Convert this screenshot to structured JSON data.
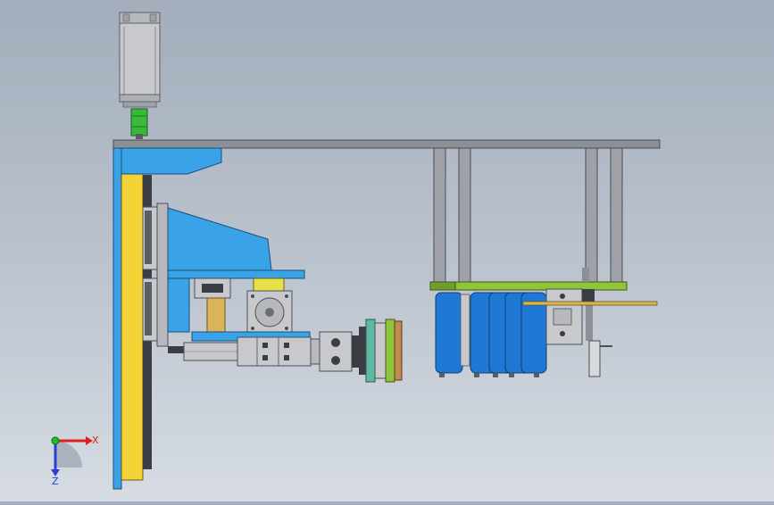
{
  "view": {
    "background_top": "#a3adbb",
    "background_bottom": "#d7dce3"
  },
  "colors": {
    "frame_blue": "#3aa2e6",
    "plate_yellow": "#f2d234",
    "plate_gray": "#8c8f96",
    "motor_gray": "#c7c9cd",
    "coupler_green": "#3ab83a",
    "bracket_green": "#8fc43b",
    "cylinder_blue": "#1f78d6",
    "rail_dark": "#3a3d44",
    "tan": "#d9b45a",
    "axis_x": "#e02020",
    "axis_y": "#1fc01f",
    "axis_z": "#2a3fd0"
  },
  "triad": {
    "x_label": "X",
    "z_label": "Z"
  }
}
